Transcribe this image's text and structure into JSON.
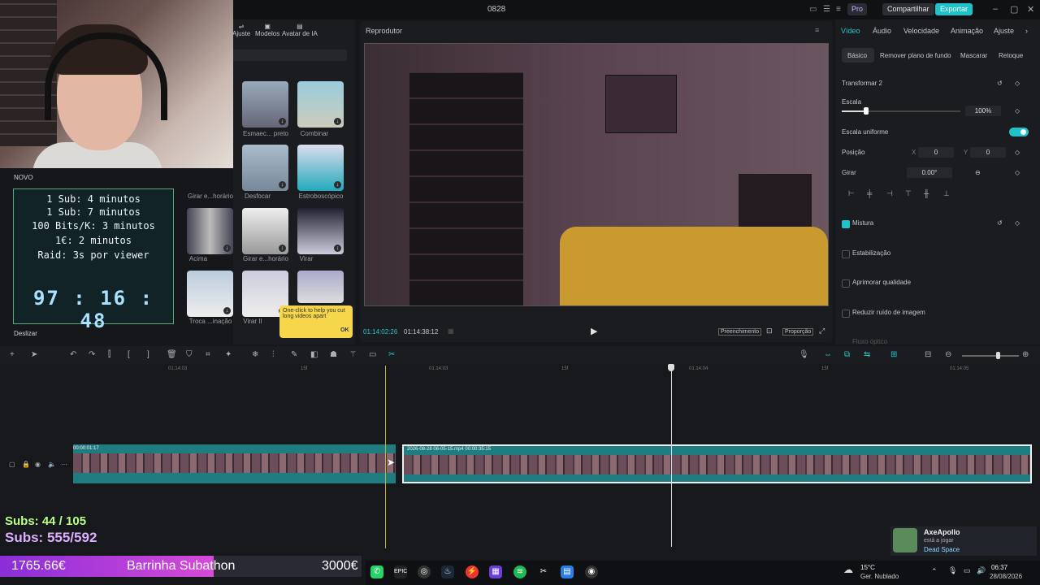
{
  "app": {
    "title": "0828",
    "pro_label": "Pro",
    "share_label": "Compartilhar",
    "export_label": "Exportar"
  },
  "media": {
    "tabs": [
      "Ajuste",
      "Modelos",
      "Avatar de IA"
    ],
    "thumbs": [
      "Esmaec... preto",
      "Combinar",
      "Desfocar",
      "Estroboscópico",
      "Girar e...horário",
      "Acima",
      "Girar e...horário",
      "Virar",
      "Troca ...inação",
      "Virar II"
    ],
    "novo_label": "NOVO",
    "deslizar_label": "Deslizar"
  },
  "overlay": {
    "rules": [
      "1 Sub: 4 minutos",
      "1 Sub: 7 minutos",
      "100 Bits/K: 3 minutos",
      "1€: 2 minutos",
      "Raid: 3s por viewer"
    ],
    "timer_h": "97",
    "timer_m": "16",
    "timer_s": "48",
    "subs1": "Subs: 44 / 105",
    "subs2": "Subs: 555/592",
    "bar_left": "1765.66€",
    "bar_title": "Barrinha Subathon",
    "bar_right": "3000€",
    "bar_fraction": 0.59
  },
  "player": {
    "title": "Reprodutor",
    "tc_current": "01:14:02:26",
    "tc_total": "01:14:38:12",
    "fill_label": "Preenchimento",
    "ratio_label": "Proporção"
  },
  "tip": {
    "text": "One-click to help you cut long videos apart",
    "ok": "OK"
  },
  "inspector": {
    "tabs": [
      "Vídeo",
      "Áudio",
      "Velocidade",
      "Animação",
      "Ajuste"
    ],
    "subtabs": [
      "Básico",
      "Remover plano de fundo",
      "Mascarar",
      "Retoque"
    ],
    "transform_label": "Transformar 2",
    "scale_label": "Escala",
    "scale_value": "100%",
    "uniform_label": "Escala uniforme",
    "position_label": "Posição",
    "pos_x_label": "X",
    "pos_x": "0",
    "pos_y_label": "Y",
    "pos_y": "0",
    "rotate_label": "Girar",
    "rotate_value": "0.00°",
    "mix_label": "Mistura",
    "stab_label": "Estabilização",
    "quality_label": "Aprimorar qualidade",
    "noise_label": "Reduzir ruído de imagem",
    "faded_label": "Fluxo óptico"
  },
  "timeline": {
    "ruler": [
      "01:14:03",
      "15f",
      "01:14:03",
      "15f",
      "01:14:04",
      "15f",
      "01:14:05"
    ],
    "clip1_label": "00:00:01:17",
    "clip2_label": "2026-08-28 06-05-15.mp4   00:00:35:15"
  },
  "taskbar": {
    "temp": "15°C",
    "condition": "Ger. Nublado",
    "time": "06:37",
    "date": "28/08/2026"
  },
  "notification": {
    "name": "AxeApollo",
    "status": "está a jogar",
    "game": "Dead Space"
  }
}
